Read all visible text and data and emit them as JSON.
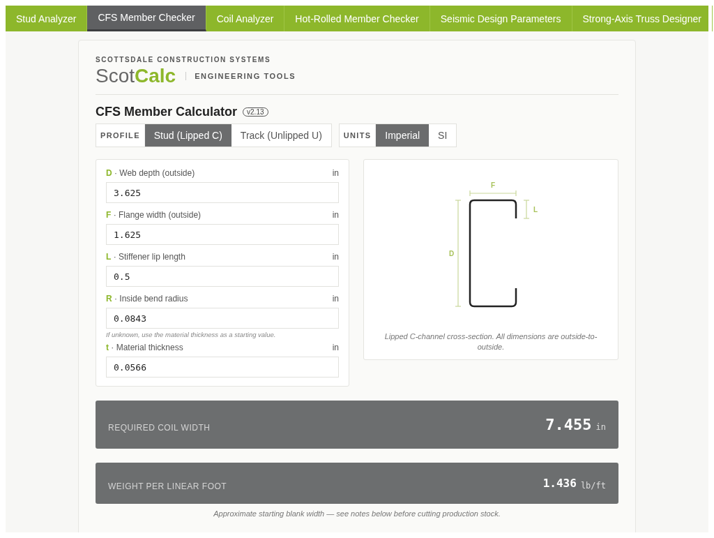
{
  "nav": [
    {
      "label": "Stud Analyzer",
      "selected": false
    },
    {
      "label": "CFS Member Checker",
      "selected": true
    },
    {
      "label": "Coil Analyzer",
      "selected": false
    },
    {
      "label": "Hot-Rolled Member Checker",
      "selected": false
    },
    {
      "label": "Seismic Design Parameters",
      "selected": false
    },
    {
      "label": "Strong-Axis Truss Designer",
      "selected": false
    }
  ],
  "brand": {
    "company": "SCOTTSDALE CONSTRUCTION SYSTEMS",
    "logo_plain": "Scot",
    "logo_accent": "Calc",
    "tagline": "ENGINEERING TOOLS"
  },
  "title": "CFS Member Calculator",
  "version": "v2.13",
  "profile": {
    "label": "PROFILE",
    "options": [
      {
        "label": "Stud (Lipped C)",
        "selected": true
      },
      {
        "label": "Track (Unlipped U)",
        "selected": false
      }
    ]
  },
  "units": {
    "label": "UNITS",
    "options": [
      {
        "label": "Imperial",
        "selected": true
      },
      {
        "label": "SI",
        "selected": false
      }
    ]
  },
  "fields": [
    {
      "symbol": "D",
      "label": "· Web depth (outside)",
      "unit": "in",
      "value": "3.625"
    },
    {
      "symbol": "F",
      "label": "· Flange width (outside)",
      "unit": "in",
      "value": "1.625"
    },
    {
      "symbol": "L",
      "label": "· Stiffener lip length",
      "unit": "in",
      "value": "0.5"
    },
    {
      "symbol": "R",
      "label": "· Inside bend radius",
      "unit": "in",
      "value": "0.0843",
      "hint": "If unknown, use the material thickness as a starting value."
    },
    {
      "symbol": "t",
      "label": "· Material thickness",
      "unit": "in",
      "value": "0.0566"
    }
  ],
  "diagram": {
    "flange_label": "F",
    "lip_label": "L",
    "depth_label": "D",
    "caption": "Lipped C-channel cross-section. All dimensions are outside-to-outside."
  },
  "results": [
    {
      "label": "REQUIRED COIL WIDTH",
      "value": "7.455",
      "unit": "in",
      "kind": "primary"
    },
    {
      "label": "WEIGHT PER LINEAR FOOT",
      "value": "1.436",
      "unit": "lb/ft",
      "kind": "secondary"
    }
  ],
  "note": "Approximate starting blank width — see notes below before cutting production stock."
}
